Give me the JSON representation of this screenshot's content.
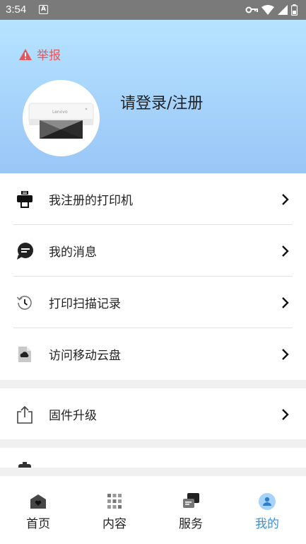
{
  "status_bar": {
    "time": "3:54",
    "notification_letter": "A"
  },
  "header": {
    "report_label": "举报",
    "login_label": "请登录/注册",
    "printer_brand": "Lenovo"
  },
  "menu": {
    "group1": [
      {
        "label": "我注册的打印机",
        "icon": "printer-icon"
      },
      {
        "label": "我的消息",
        "icon": "message-icon"
      },
      {
        "label": "打印扫描记录",
        "icon": "history-icon"
      },
      {
        "label": "访问移动云盘",
        "icon": "cloud-file-icon"
      }
    ],
    "group2": [
      {
        "label": "固件升级",
        "icon": "upload-icon"
      }
    ]
  },
  "tabs": [
    {
      "label": "首页",
      "icon": "home-icon",
      "active": false
    },
    {
      "label": "内容",
      "icon": "grid-icon",
      "active": false
    },
    {
      "label": "服务",
      "icon": "service-icon",
      "active": false
    },
    {
      "label": "我的",
      "icon": "profile-icon",
      "active": true
    }
  ],
  "colors": {
    "accent": "#3d8fd6",
    "report": "#e5575c",
    "header_top": "#b6e4ff",
    "header_bottom": "#99c6f6"
  }
}
